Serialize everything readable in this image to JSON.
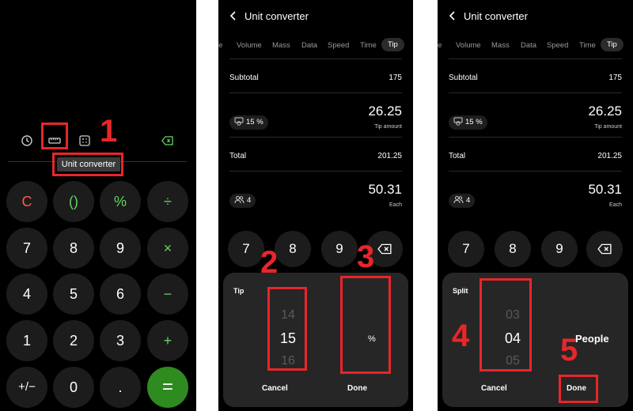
{
  "colors": {
    "background": "#000000",
    "accent_green": "#62d65f",
    "equals_button": "#2e8b1f",
    "clear_red": "#ff5a4a",
    "annotation_red": "#e8262a"
  },
  "calculator": {
    "tooltip": "Unit converter",
    "toolbar_icons": [
      "history-icon",
      "ruler-icon",
      "calculator-icon",
      "backspace-icon"
    ],
    "keys": {
      "clear": "C",
      "parens": "()",
      "percent": "%",
      "divide": "÷",
      "seven": "7",
      "eight": "8",
      "nine": "9",
      "multiply": "×",
      "four": "4",
      "five": "5",
      "six": "6",
      "minus": "−",
      "one": "1",
      "two": "2",
      "three": "3",
      "plus": "+",
      "sign": "+/−",
      "zero": "0",
      "decimal": ".",
      "equals": "="
    }
  },
  "converter": {
    "title": "Unit converter",
    "tabs": [
      "re",
      "Volume",
      "Mass",
      "Data",
      "Speed",
      "Time",
      "Tip"
    ],
    "active_tab": "Tip",
    "subtotal_label": "Subtotal",
    "subtotal_value": "175",
    "tip_chip": "15 %",
    "tip_amount": "26.25",
    "tip_amount_label": "Tip amount",
    "total_label": "Total",
    "total_value": "201.25",
    "people_chip": "4",
    "each_amount": "50.31",
    "each_label": "Each",
    "keys": [
      "7",
      "8",
      "9"
    ]
  },
  "tip_sheet": {
    "title": "Tip",
    "picker_above": "14",
    "picker_selected": "15",
    "picker_below": "16",
    "unit": "%",
    "cancel": "Cancel",
    "done": "Done"
  },
  "split_sheet": {
    "title": "Split",
    "picker_above": "03",
    "picker_selected": "04",
    "picker_below": "05",
    "unit": "People",
    "cancel": "Cancel",
    "done": "Done"
  },
  "annotations": [
    "1",
    "2",
    "3",
    "4",
    "5"
  ]
}
